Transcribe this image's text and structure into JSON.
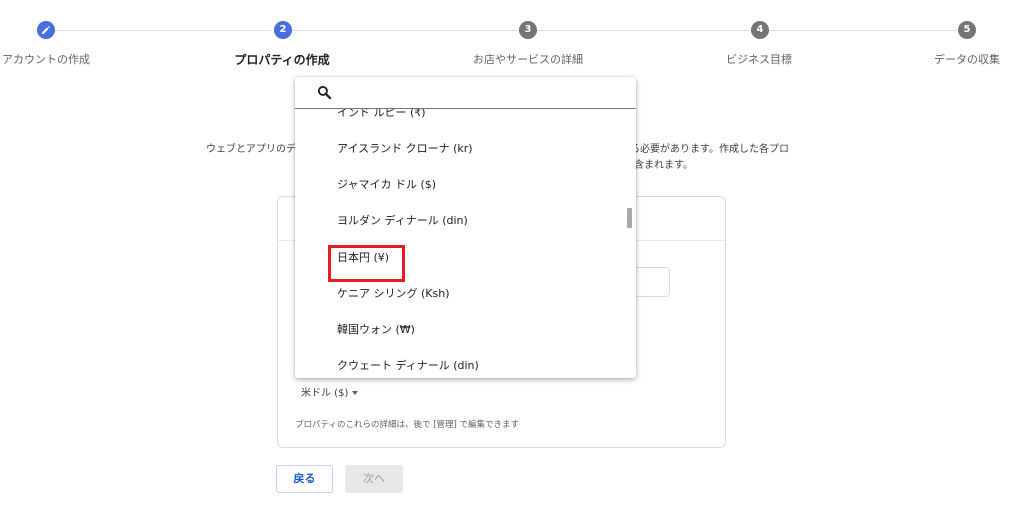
{
  "stepper": {
    "steps": [
      {
        "number": "",
        "label": "アカウントの作成"
      },
      {
        "number": "2",
        "label": "プロパティの作成"
      },
      {
        "number": "3",
        "label": "お店やサービスの詳細"
      },
      {
        "number": "4",
        "label": "ビジネス目標"
      },
      {
        "number": "5",
        "label": "データの収集"
      }
    ]
  },
  "description": {
    "line1_left": "ウェブとアプリのデ",
    "line1_right": "る必要があります。作成した各プロ",
    "line2_right": "含まれます。"
  },
  "currency": {
    "selected": "米ドル ($)",
    "search_placeholder": "",
    "options": [
      "インド ルピー (₹)",
      "アイスランド クローナ (kr)",
      "ジャマイカ ドル ($)",
      "ヨルダン ディナール (din)",
      "日本円 (¥)",
      "ケニア シリング (Ksh)",
      "韓国ウォン (₩)",
      "クウェート ディナール (din)"
    ]
  },
  "card": {
    "note": "プロパティのこれらの詳細は、後で [管理] で編集できます"
  },
  "buttons": {
    "back": "戻る",
    "next": "次へ"
  },
  "colors": {
    "active_step": "#4a6ee0",
    "inactive_step": "#757575",
    "highlight": "#e51c23",
    "primary_text": "#1a57d6"
  }
}
